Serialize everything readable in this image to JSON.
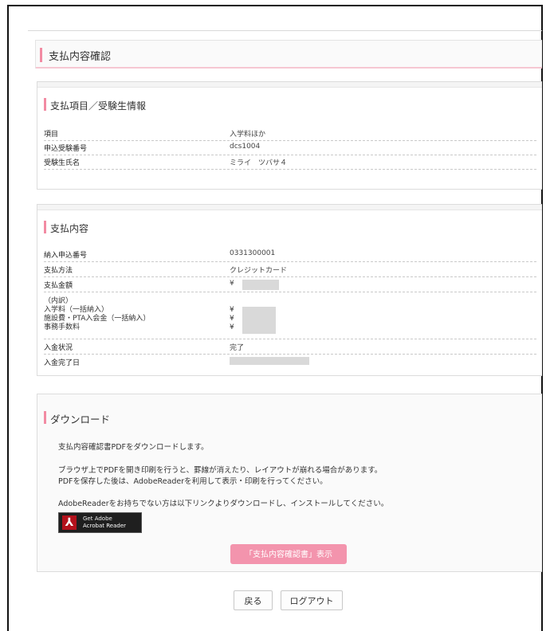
{
  "page": {
    "title": "支払内容確認"
  },
  "applicant": {
    "title": "支払項目／受験生情報",
    "rows": [
      {
        "label": "項目",
        "value": "入学料ほか"
      },
      {
        "label": "申込受験番号",
        "value": "dcs1004"
      },
      {
        "label": "受験生氏名",
        "value": "ミライ　ツバサ４"
      }
    ]
  },
  "payment": {
    "title": "支払内容",
    "number_label": "納入申込番号",
    "number_value": "0331300001",
    "method_label": "支払方法",
    "method_value": "クレジットカード",
    "amount_label": "支払金額",
    "amount_prefix": "¥",
    "breakdown_label": "（内訳）",
    "breakdown_items": [
      "入学料（一括納入）",
      "施設費・PTA入会金（一括納入）",
      "事務手数料"
    ],
    "yen": "¥",
    "status_label": "入金状況",
    "status_value": "完了",
    "completed_label": "入金完了日"
  },
  "download": {
    "title": "ダウンロード",
    "line1": "支払内容確認書PDFをダウンロードします。",
    "line2": "ブラウザ上でPDFを開き印刷を行うと、罫線が消えたり、レイアウトが崩れる場合があります。",
    "line3": "PDFを保存した後は、AdobeReaderを利用して表示・印刷を行ってください。",
    "line4": "AdobeReaderをお持ちでない方は以下リンクよりダウンロードし、インストールしてください。",
    "badge_top": "Get Adobe",
    "badge_bottom": "Acrobat Reader",
    "pdf_button": "「支払内容確認書」表示"
  },
  "footer": {
    "back": "戻る",
    "logout": "ログアウト"
  },
  "colors": {
    "accent": "#f28ba3",
    "button_pink": "#f394ad"
  }
}
